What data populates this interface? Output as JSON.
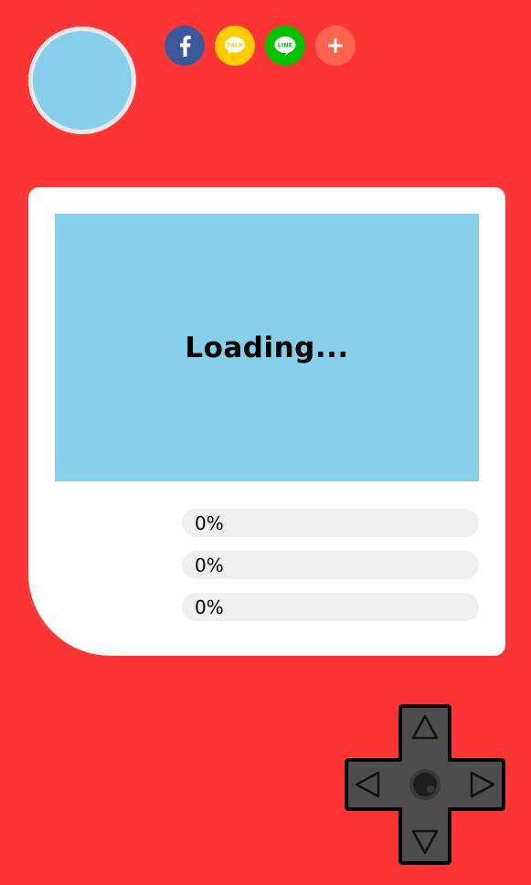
{
  "profile": {
    "avatar_color": "#87ceeb"
  },
  "share": [
    {
      "name": "facebook",
      "icon": "facebook-icon",
      "color": "#3b5998"
    },
    {
      "name": "kakaotalk",
      "icon": "kakaotalk-icon",
      "color": "#ffcc00",
      "label": "TALK"
    },
    {
      "name": "line",
      "icon": "line-icon",
      "color": "#00c300",
      "label": "LINE"
    },
    {
      "name": "more",
      "icon": "plus-icon",
      "color": "#ff6450"
    }
  ],
  "screen": {
    "status_text": "Loading...",
    "color": "#87ceeb"
  },
  "progress": [
    {
      "percent": 0,
      "label": "0%"
    },
    {
      "percent": 0,
      "label": "0%"
    },
    {
      "percent": 0,
      "label": "0%"
    }
  ],
  "theme": {
    "background": "#ff3535",
    "card": "#ffffff",
    "bar_track": "#efefef",
    "dpad": "#4d4d4d"
  }
}
